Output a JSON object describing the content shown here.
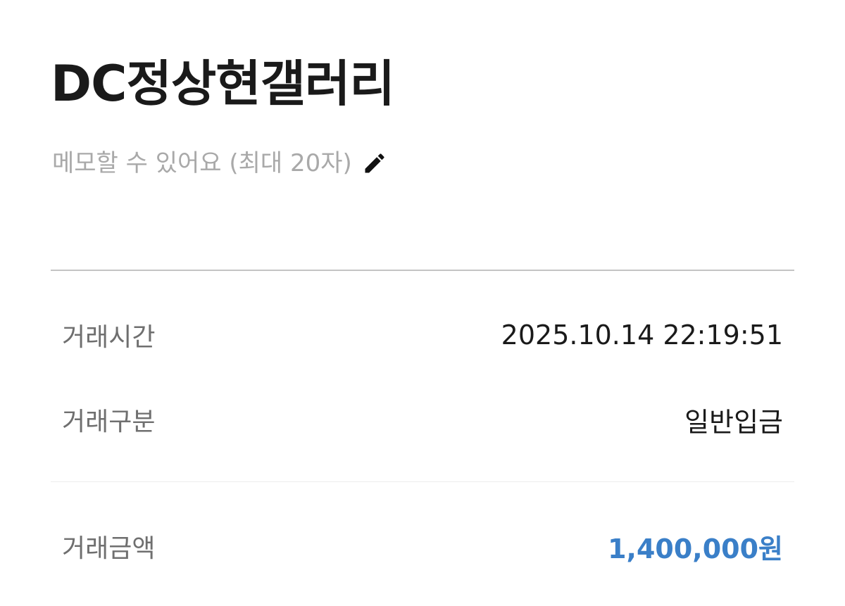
{
  "header": {
    "title": "DC정상현갤러리",
    "memo_placeholder": "메모할 수 있어요 (최대 20자)",
    "memo_icon": "pencil-edit-icon"
  },
  "details": {
    "time": {
      "label": "거래시간",
      "value": "2025.10.14 22:19:51"
    },
    "type": {
      "label": "거래구분",
      "value": "일반입금"
    }
  },
  "amount": {
    "label": "거래금액",
    "value": "1,400,000원"
  },
  "colors": {
    "title": "#1a1a1a",
    "placeholder": "#a9a9a9",
    "label": "#6f6f6f",
    "amount_accent": "#3a7fc8",
    "divider": "#c4c4c4"
  }
}
